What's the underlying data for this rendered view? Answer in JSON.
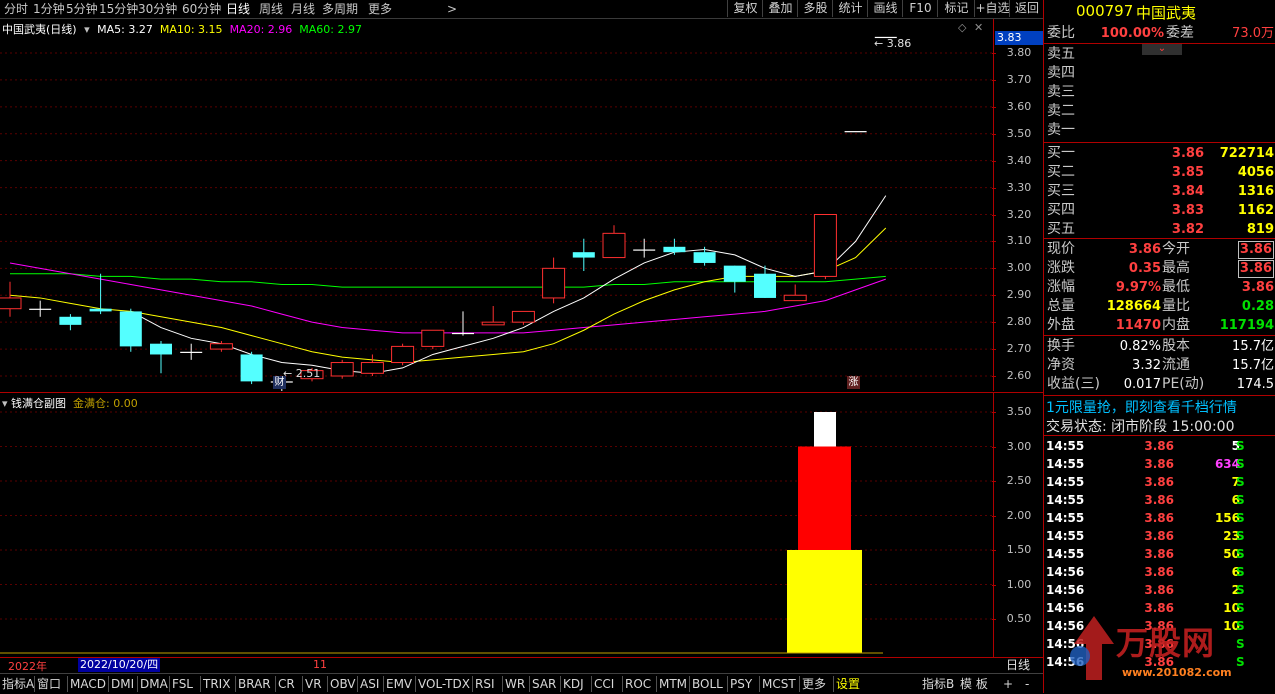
{
  "toolbar": {
    "periods": [
      "分时",
      "1分钟",
      "5分钟",
      "15分钟",
      "30分钟",
      "60分钟",
      "日线",
      "周线",
      "月线",
      "多周期",
      "更多"
    ],
    "active_period": "日线",
    "more_arrow": ">",
    "buttons": [
      "复权",
      "叠加",
      "多股",
      "统计",
      "画线",
      "F10",
      "标记",
      "+自选",
      "返回"
    ]
  },
  "main_legend": {
    "title": "中国武夷(日线)",
    "ma5": "MA5: 3.27",
    "ma10": "MA10: 3.15",
    "ma20": "MA20: 2.96",
    "ma60": "MA60: 2.97",
    "colors": {
      "ma5": "#ffffff",
      "ma10": "#ffff00",
      "ma20": "#ff00ff",
      "ma60": "#00ff00"
    }
  },
  "price_marker": "3.83",
  "high_label": "3.86",
  "low_label": "2.51",
  "cai_badge": "财",
  "zhang_badge": "涨",
  "main_yaxis": [
    "3.80",
    "3.70",
    "3.60",
    "3.50",
    "3.40",
    "3.30",
    "3.20",
    "3.10",
    "3.00",
    "2.90",
    "2.80",
    "2.70",
    "2.60"
  ],
  "sub_legend": {
    "title": "钱满仓副图",
    "item": "金满仓: 0.00"
  },
  "sub_yaxis": [
    "3.50",
    "3.00",
    "2.50",
    "2.00",
    "1.50",
    "1.00",
    "0.50"
  ],
  "date_bar": {
    "year": "2022年",
    "date": "2022/10/20/四",
    "month_mark": "11",
    "period_label": "日线"
  },
  "indicators": [
    "指标A",
    "窗口",
    "MACD",
    "DMI",
    "DMA",
    "FSL",
    "TRIX",
    "BRAR",
    "CR",
    "VR",
    "OBV",
    "ASI",
    "EMV",
    "VOL-TDX",
    "RSI",
    "WR",
    "SAR",
    "KDJ",
    "CCI",
    "ROC",
    "MTM",
    "BOLL",
    "PSY",
    "MCST",
    "更多",
    "设置"
  ],
  "indicator_right": [
    "指标B",
    "模 板",
    "+",
    "-"
  ],
  "chart_data": {
    "type": "candlestick",
    "ylim": [
      2.5,
      3.86
    ],
    "candles": [
      {
        "o": 2.85,
        "c": 2.89,
        "h": 2.95,
        "l": 2.82,
        "up": true
      },
      {
        "o": 2.85,
        "c": 2.85,
        "h": 2.88,
        "l": 2.82,
        "up": true
      },
      {
        "o": 2.82,
        "c": 2.79,
        "h": 2.83,
        "l": 2.77,
        "up": false
      },
      {
        "o": 2.85,
        "c": 2.84,
        "h": 2.98,
        "l": 2.83,
        "up": false
      },
      {
        "o": 2.84,
        "c": 2.71,
        "h": 2.85,
        "l": 2.69,
        "up": false
      },
      {
        "o": 2.72,
        "c": 2.68,
        "h": 2.73,
        "l": 2.61,
        "up": false
      },
      {
        "o": 2.69,
        "c": 2.69,
        "h": 2.72,
        "l": 2.66,
        "up": true
      },
      {
        "o": 2.7,
        "c": 2.72,
        "h": 2.73,
        "l": 2.69,
        "up": true
      },
      {
        "o": 2.68,
        "c": 2.58,
        "h": 2.69,
        "l": 2.57,
        "up": false
      },
      {
        "o": 2.58,
        "c": 2.58,
        "h": 2.6,
        "l": 2.51,
        "up": true
      },
      {
        "o": 2.59,
        "c": 2.62,
        "h": 2.63,
        "l": 2.58,
        "up": true
      },
      {
        "o": 2.6,
        "c": 2.65,
        "h": 2.66,
        "l": 2.59,
        "up": true
      },
      {
        "o": 2.61,
        "c": 2.65,
        "h": 2.68,
        "l": 2.6,
        "up": true
      },
      {
        "o": 2.65,
        "c": 2.71,
        "h": 2.72,
        "l": 2.64,
        "up": true
      },
      {
        "o": 2.71,
        "c": 2.77,
        "h": 2.77,
        "l": 2.7,
        "up": true
      },
      {
        "o": 2.76,
        "c": 2.76,
        "h": 2.84,
        "l": 2.75,
        "up": false
      },
      {
        "o": 2.79,
        "c": 2.8,
        "h": 2.86,
        "l": 2.79,
        "up": true
      },
      {
        "o": 2.8,
        "c": 2.84,
        "h": 2.84,
        "l": 2.79,
        "up": true
      },
      {
        "o": 2.89,
        "c": 3.0,
        "h": 3.04,
        "l": 2.87,
        "up": true
      },
      {
        "o": 3.06,
        "c": 3.04,
        "h": 3.11,
        "l": 2.99,
        "up": false
      },
      {
        "o": 3.04,
        "c": 3.13,
        "h": 3.16,
        "l": 3.04,
        "up": true
      },
      {
        "o": 3.07,
        "c": 3.07,
        "h": 3.11,
        "l": 3.04,
        "up": true
      },
      {
        "o": 3.08,
        "c": 3.06,
        "h": 3.11,
        "l": 3.05,
        "up": false
      },
      {
        "o": 3.06,
        "c": 3.02,
        "h": 3.08,
        "l": 3.01,
        "up": false
      },
      {
        "o": 3.01,
        "c": 2.95,
        "h": 3.01,
        "l": 2.91,
        "up": false
      },
      {
        "o": 2.98,
        "c": 2.89,
        "h": 3.01,
        "l": 2.89,
        "up": false
      },
      {
        "o": 2.88,
        "c": 2.9,
        "h": 2.94,
        "l": 2.88,
        "up": true
      },
      {
        "o": 2.97,
        "c": 3.2,
        "h": 3.2,
        "l": 2.96,
        "up": true
      },
      {
        "o": 3.51,
        "c": 3.51,
        "h": 3.51,
        "l": 3.51,
        "up": true
      },
      {
        "o": 3.86,
        "c": 3.86,
        "h": 3.86,
        "l": 3.86,
        "up": true
      }
    ],
    "ma5": [
      null,
      null,
      null,
      null,
      2.84,
      2.78,
      2.74,
      2.72,
      2.68,
      2.65,
      2.64,
      2.62,
      2.61,
      2.63,
      2.68,
      2.71,
      2.74,
      2.78,
      2.84,
      2.89,
      2.96,
      3.02,
      3.06,
      3.07,
      3.05,
      3.0,
      2.97,
      2.99,
      3.1,
      3.27
    ],
    "ma10": [
      2.9,
      2.89,
      2.87,
      2.85,
      2.84,
      2.82,
      2.8,
      2.78,
      2.75,
      2.72,
      2.69,
      2.67,
      2.66,
      2.65,
      2.66,
      2.67,
      2.68,
      2.69,
      2.72,
      2.77,
      2.83,
      2.88,
      2.92,
      2.95,
      2.97,
      2.97,
      2.97,
      2.99,
      3.04,
      3.15
    ],
    "ma20": [
      3.02,
      3.0,
      2.98,
      2.96,
      2.94,
      2.92,
      2.9,
      2.88,
      2.86,
      2.83,
      2.8,
      2.78,
      2.77,
      2.76,
      2.76,
      2.76,
      2.76,
      2.76,
      2.77,
      2.78,
      2.79,
      2.8,
      2.81,
      2.82,
      2.83,
      2.84,
      2.86,
      2.88,
      2.92,
      2.96
    ],
    "ma60": [
      2.98,
      2.98,
      2.98,
      2.97,
      2.97,
      2.96,
      2.96,
      2.95,
      2.95,
      2.94,
      2.94,
      2.93,
      2.93,
      2.93,
      2.93,
      2.93,
      2.93,
      2.93,
      2.93,
      2.93,
      2.94,
      2.94,
      2.95,
      2.95,
      2.95,
      2.95,
      2.95,
      2.95,
      2.96,
      2.97
    ],
    "sub_bars": {
      "ylim": [
        0,
        3.5
      ],
      "yellow": 1.5,
      "red": 3.0,
      "white": 3.5
    }
  },
  "right_panel": {
    "code": "000797",
    "name": "中国武夷",
    "weibi_label": "委比",
    "weibi_value": "100.00%",
    "weicha_label": "委差",
    "weicha_value": "73.0万",
    "sells": [
      "卖五",
      "卖四",
      "卖三",
      "卖二",
      "卖一"
    ],
    "buys": [
      {
        "label": "买一",
        "price": "3.86",
        "vol": "722714"
      },
      {
        "label": "买二",
        "price": "3.85",
        "vol": "4056"
      },
      {
        "label": "买三",
        "price": "3.84",
        "vol": "1316"
      },
      {
        "label": "买四",
        "price": "3.83",
        "vol": "1162"
      },
      {
        "label": "买五",
        "price": "3.82",
        "vol": "819"
      }
    ],
    "stats": [
      {
        "l1": "现价",
        "v1": "3.86",
        "l2": "今开",
        "v2": "3.86",
        "c1": "red",
        "c2": "red",
        "box2": true
      },
      {
        "l1": "涨跌",
        "v1": "0.35",
        "l2": "最高",
        "v2": "3.86",
        "c1": "red",
        "c2": "red",
        "box2": true
      },
      {
        "l1": "涨幅",
        "v1": "9.97%",
        "l2": "最低",
        "v2": "3.86",
        "c1": "red",
        "c2": "red",
        "box2": false
      },
      {
        "l1": "总量",
        "v1": "128664",
        "l2": "量比",
        "v2": "0.28",
        "c1": "yel",
        "c2": "grn",
        "box2": false
      },
      {
        "l1": "外盘",
        "v1": "11470",
        "l2": "内盘",
        "v2": "117194",
        "c1": "red",
        "c2": "grn",
        "box2": false
      }
    ],
    "stats2": [
      {
        "l1": "换手",
        "v1": "0.82%",
        "l2": "股本",
        "v2": "15.7亿"
      },
      {
        "l1": "净资",
        "v1": "3.32",
        "l2": "流通",
        "v2": "15.7亿"
      },
      {
        "l1": "收益(三)",
        "v1": "0.017",
        "l2": "PE(动)",
        "v2": "174.5"
      }
    ],
    "promo": "1元限量抢，即刻查看千档行情",
    "trade_status": "交易状态: 闭市阶段 15:00:00",
    "ticks": [
      {
        "t": "14:55",
        "p": "3.86",
        "v": "5",
        "s": "S",
        "vc": "wht"
      },
      {
        "t": "14:55",
        "p": "3.86",
        "v": "634",
        "s": "S",
        "vc": "mag"
      },
      {
        "t": "14:55",
        "p": "3.86",
        "v": "7",
        "s": "S",
        "vc": "yel"
      },
      {
        "t": "14:55",
        "p": "3.86",
        "v": "6",
        "s": "S",
        "vc": "yel"
      },
      {
        "t": "14:55",
        "p": "3.86",
        "v": "156",
        "s": "S",
        "vc": "yel"
      },
      {
        "t": "14:55",
        "p": "3.86",
        "v": "23",
        "s": "S",
        "vc": "yel"
      },
      {
        "t": "14:55",
        "p": "3.86",
        "v": "50",
        "s": "S",
        "vc": "yel"
      },
      {
        "t": "14:56",
        "p": "3.86",
        "v": "6",
        "s": "S",
        "vc": "yel"
      },
      {
        "t": "14:56",
        "p": "3.86",
        "v": "2",
        "s": "S",
        "vc": "yel"
      },
      {
        "t": "14:56",
        "p": "3.86",
        "v": "10",
        "s": "S",
        "vc": "yel"
      },
      {
        "t": "14:56",
        "p": "3.86",
        "v": "10",
        "s": "S",
        "vc": "yel"
      },
      {
        "t": "14:56",
        "p": "3.86",
        "v": "",
        "s": "S",
        "vc": "yel"
      },
      {
        "t": "14:56",
        "p": "3.86",
        "v": "",
        "s": "S",
        "vc": "yel"
      }
    ],
    "tick_last_col": "1",
    "watermark": "万股网",
    "watermark_url": "www.201082.com"
  }
}
